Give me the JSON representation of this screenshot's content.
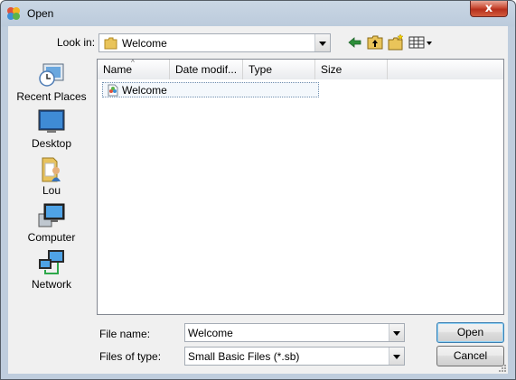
{
  "window": {
    "title": "Open",
    "close_symbol": "x"
  },
  "toolbar": {
    "look_in_label": "Look in:",
    "look_in_value": "Welcome",
    "icons": [
      "back-arrow-icon",
      "up-folder-icon",
      "new-folder-icon",
      "views-menu-icon"
    ]
  },
  "places": [
    {
      "label": "Recent Places",
      "icon": "recent-places-icon"
    },
    {
      "label": "Desktop",
      "icon": "desktop-icon"
    },
    {
      "label": "Lou",
      "icon": "user-folder-icon"
    },
    {
      "label": "Computer",
      "icon": "computer-icon"
    },
    {
      "label": "Network",
      "icon": "network-icon"
    }
  ],
  "file_list": {
    "columns": [
      "Name",
      "Date modif...",
      "Type",
      "Size"
    ],
    "sort_column": "Name",
    "items": [
      {
        "name": "Welcome",
        "icon": "small-basic-file-icon",
        "selected": true
      }
    ]
  },
  "file_name": {
    "label": "File name:",
    "value": "Welcome"
  },
  "file_type": {
    "label": "Files of type:",
    "value": "Small Basic Files (*.sb)"
  },
  "buttons": {
    "open": "Open",
    "cancel": "Cancel"
  },
  "colors": {
    "title_bar": "#bfcddd",
    "close_button": "#c94a34",
    "dialog_bg": "#f0f0f0",
    "selection_border": "#6f8eaf"
  }
}
